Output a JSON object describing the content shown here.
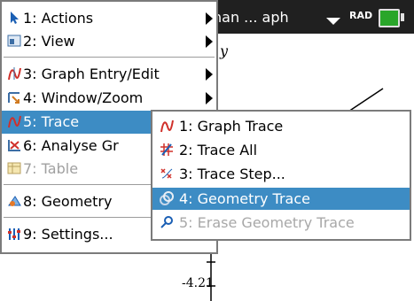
{
  "titlebar": {
    "doc_title": "han ... aph",
    "mode": "RAD"
  },
  "graph": {
    "y_letter": "y",
    "axis_tick_label": "-4.21"
  },
  "main_menu": {
    "items": [
      {
        "label": "1: Actions",
        "icon": "cursor-arrow-icon",
        "submenu": true
      },
      {
        "label": "2: View",
        "icon": "view-window-icon",
        "submenu": true
      },
      {
        "label": "3: Graph Entry/Edit",
        "icon": "graph-entry-icon",
        "submenu": true
      },
      {
        "label": "4: Window/Zoom",
        "icon": "window-zoom-icon",
        "submenu": true
      },
      {
        "label": "5: Trace",
        "icon": "trace-icon",
        "submenu": true,
        "selected": true
      },
      {
        "label": "6: Analyse Gr",
        "icon": "analyse-graph-icon",
        "submenu": true
      },
      {
        "label": "7: Table",
        "icon": "table-icon",
        "submenu": false,
        "disabled": true
      },
      {
        "label": "8: Geometry",
        "icon": "geometry-icon",
        "submenu": true
      },
      {
        "label": "9: Settings...",
        "icon": "settings-icon",
        "submenu": false
      }
    ]
  },
  "trace_submenu": {
    "items": [
      {
        "label": "1: Graph Trace",
        "icon": "graph-trace-icon"
      },
      {
        "label": "2: Trace All",
        "icon": "trace-all-icon"
      },
      {
        "label": "3: Trace Step...",
        "icon": "trace-step-icon"
      },
      {
        "label": "4: Geometry Trace",
        "icon": "geometry-trace-icon",
        "selected": true
      },
      {
        "label": "5: Erase Geometry Trace",
        "icon": "erase-geometry-trace-icon",
        "disabled": true
      }
    ]
  },
  "colors": {
    "selection": "#3d8cc4",
    "titlebar": "#202020",
    "disabled_text": "#a0a0a0"
  }
}
